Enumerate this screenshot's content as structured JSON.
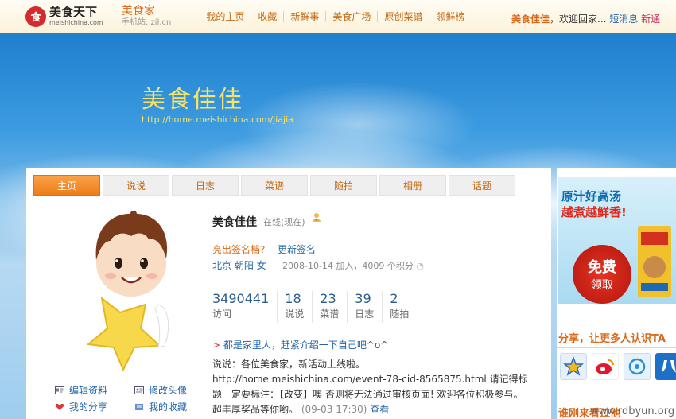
{
  "topbar": {
    "logo_cn": "美食天下",
    "logo_en": "meishichina.com",
    "site_title": "美食家",
    "mobile_site": "手机站: zil.cn",
    "nav": [
      "我的主页",
      "收藏",
      "新鲜事",
      "美食广场",
      "原创菜谱",
      "领鲜榜"
    ],
    "username": "美食佳佳",
    "welcome": "，欢迎回家...",
    "messages": "短消息",
    "new_link": "新通"
  },
  "banner": {
    "title": "美食佳佳",
    "url": "http://home.meishichina.com/jiajia"
  },
  "tabs": [
    "主页",
    "说说",
    "日志",
    "菜谱",
    "随拍",
    "相册",
    "话题"
  ],
  "profile": {
    "name": "美食佳佳",
    "status": "在线(现在)",
    "sig_prompt": "亮出签名档?",
    "sig_update": "更新签名",
    "location": "北京 朝阳 女",
    "joined": "2008-10-14 加入，4009 个积分",
    "stats": [
      {
        "num": "3490441",
        "label": "访问"
      },
      {
        "num": "18",
        "label": "说说"
      },
      {
        "num": "23",
        "label": "菜谱"
      },
      {
        "num": "39",
        "label": "日志"
      },
      {
        "num": "2",
        "label": "随拍"
      }
    ],
    "invite": "都是家里人，赶紧介绍一下自己吧^o^",
    "news": {
      "text": "说说：各位美食家，新活动上线啦。 http://home.meishichina.com/event-78-cid-8565875.html 请记得标题一定要标注：【改变】噢 否则将无法通过审核页面! 欢迎各位积极参与。超丰厚奖品等你哟。",
      "time": "(09-03 17:30)",
      "view": "查看"
    },
    "links": {
      "edit": "编辑资料",
      "avatar": "修改头像",
      "share": "我的分享",
      "fav": "我的收藏"
    }
  },
  "sidebar": {
    "ad_line1": "原汁好高汤",
    "ad_line2": "越煮越鲜香!",
    "ad_btn1": "免费",
    "ad_btn2": "领取",
    "share_title": "分享，让更多人认识TA",
    "bottom_title": "谁刚来看过他"
  },
  "watermark": "www.rdbyun.org",
  "colors": {
    "accent": "#ee7d17",
    "link": "#2264a8",
    "title": "#f5e36a"
  }
}
